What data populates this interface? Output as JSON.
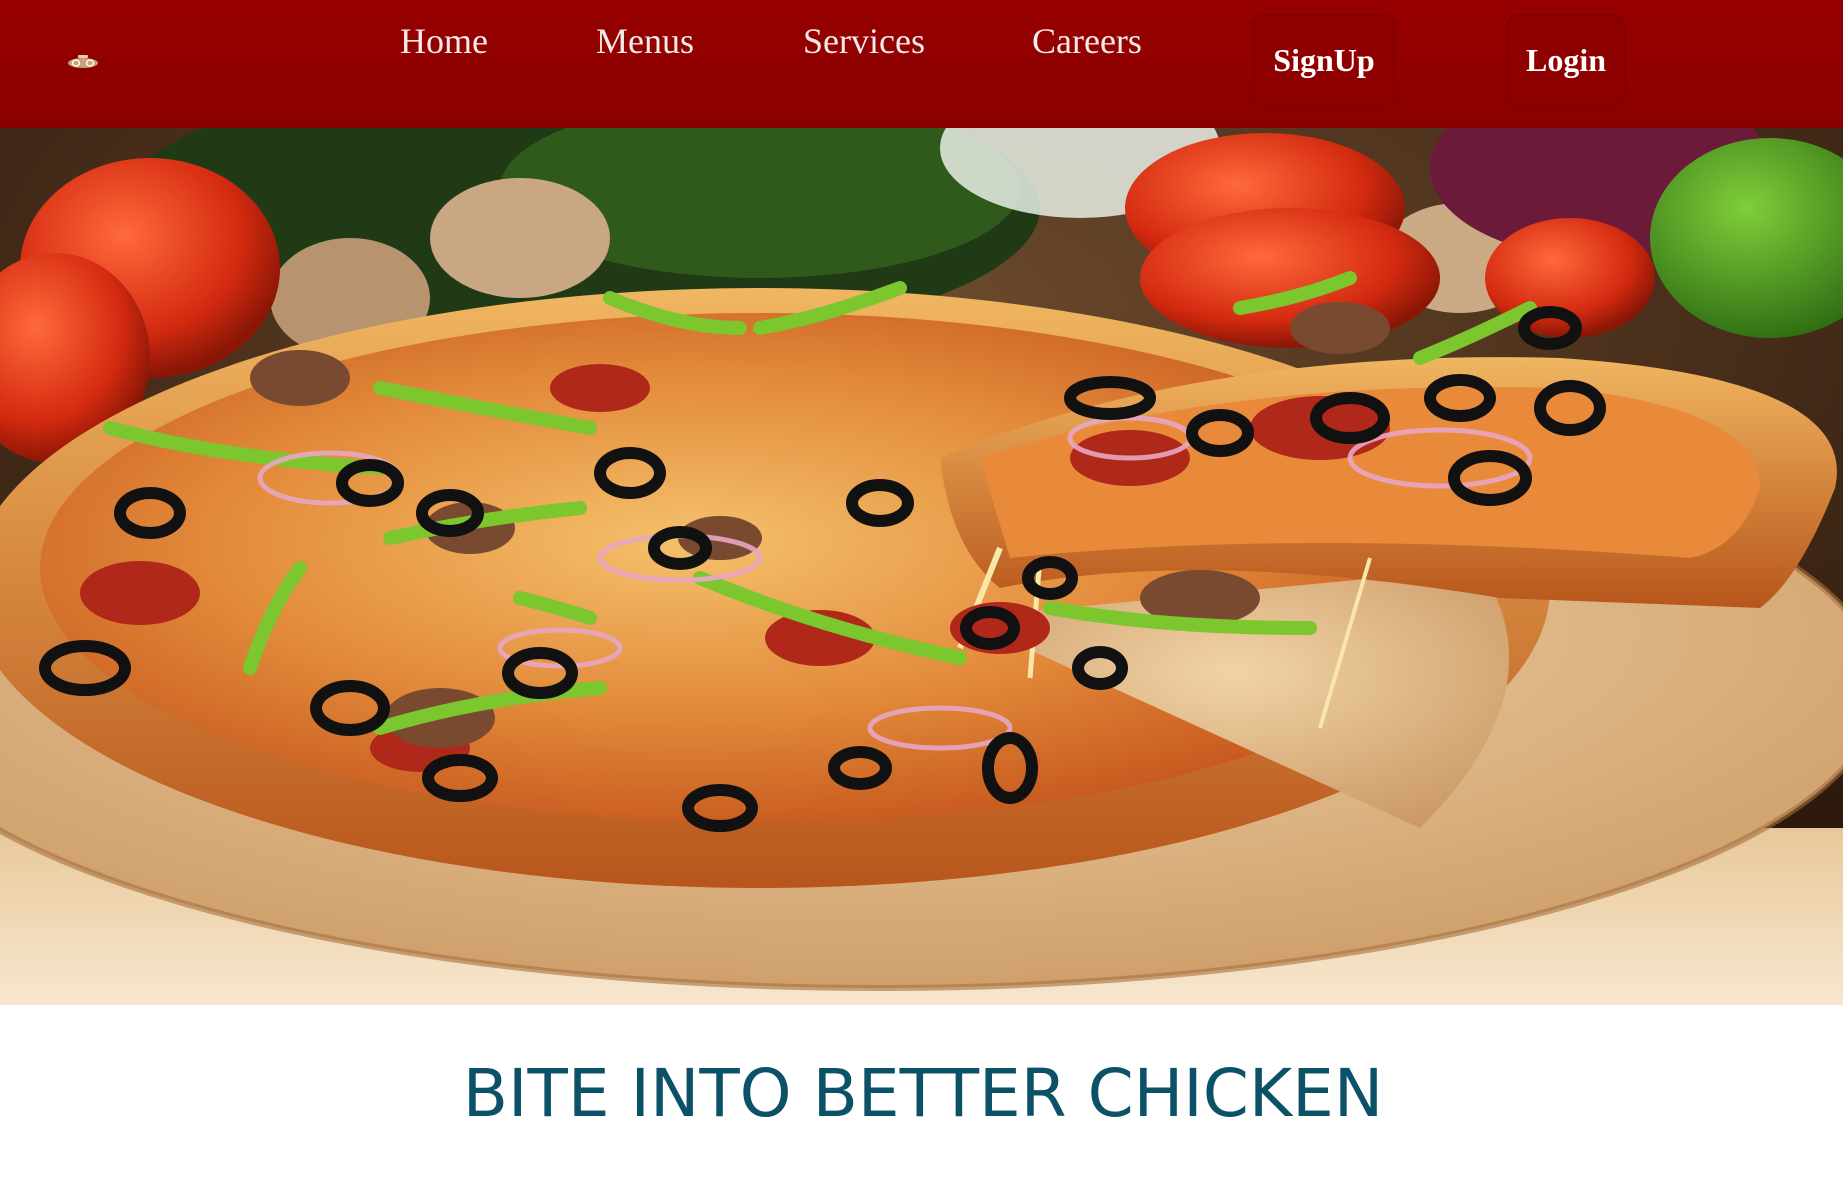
{
  "nav": {
    "links": [
      {
        "label": "Home"
      },
      {
        "label": "Menus"
      },
      {
        "label": "Services"
      },
      {
        "label": "Careers"
      }
    ],
    "signup_label": "SignUp",
    "login_label": "Login",
    "logo_icon": "pizza-logo-icon"
  },
  "hero": {
    "image_subject": "pizza-photo"
  },
  "headline": "BITE INTO BETTER CHICKEN",
  "colors": {
    "navbar": "#950000",
    "nav_text": "#f4eaea",
    "button_bg": "#8f0000",
    "headline": "#0b5168",
    "page_bg": "#ffffff"
  }
}
